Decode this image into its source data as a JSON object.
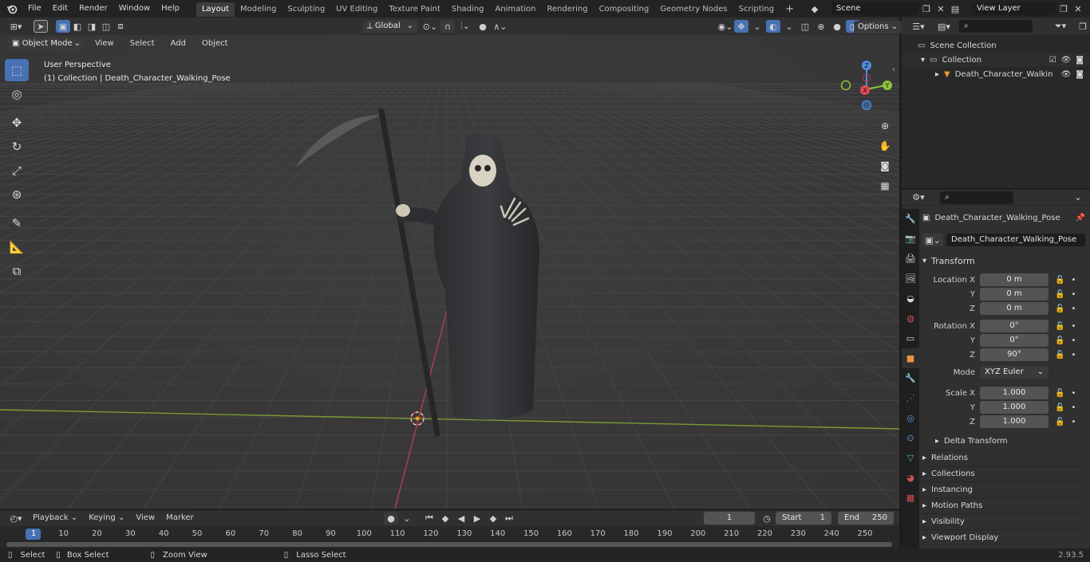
{
  "topbar": {
    "menus": [
      "File",
      "Edit",
      "Render",
      "Window",
      "Help"
    ],
    "workspaces": [
      "Layout",
      "Modeling",
      "Sculpting",
      "UV Editing",
      "Texture Paint",
      "Shading",
      "Animation",
      "Rendering",
      "Compositing",
      "Geometry Nodes",
      "Scripting"
    ],
    "active_workspace": "Layout",
    "add_tab": "+",
    "scene": "Scene",
    "view_layer": "View Layer"
  },
  "viewport_header": {
    "mode": "Object Mode",
    "menus": [
      "View",
      "Select",
      "Add",
      "Object"
    ],
    "orientation": "Global",
    "options": "Options"
  },
  "viewport": {
    "perspective": "User Perspective",
    "collection_info": "(1) Collection | Death_Character_Walking_Pose",
    "gizmo": {
      "x": "X",
      "y": "Y",
      "z": "Z"
    }
  },
  "outliner": {
    "scene_collection": "Scene Collection",
    "collection": "Collection",
    "object": "Death_Character_Walkin"
  },
  "properties": {
    "object_name": "Death_Character_Walking_Pose",
    "object_field": "Death_Character_Walking_Pose",
    "transform_title": "Transform",
    "location_label": "Location X",
    "rotation_label": "Rotation X",
    "scale_label": "Scale X",
    "y_label": "Y",
    "z_label": "Z",
    "location": [
      "0 m",
      "0 m",
      "0 m"
    ],
    "rotation": [
      "0°",
      "0°",
      "90°"
    ],
    "mode_label": "Mode",
    "mode_value": "XYZ Euler",
    "scale": [
      "1.000",
      "1.000",
      "1.000"
    ],
    "delta": "Delta Transform",
    "sections": [
      "Relations",
      "Collections",
      "Instancing",
      "Motion Paths",
      "Visibility",
      "Viewport Display"
    ]
  },
  "timeline": {
    "menus": [
      "Playback",
      "Keying",
      "View",
      "Marker"
    ],
    "current_frame": "1",
    "start_label": "Start",
    "start": "1",
    "end_label": "End",
    "end": "250",
    "ticks": [
      "1",
      "10",
      "20",
      "30",
      "40",
      "50",
      "60",
      "70",
      "80",
      "90",
      "100",
      "110",
      "120",
      "130",
      "140",
      "150",
      "160",
      "170",
      "180",
      "190",
      "200",
      "210",
      "220",
      "230",
      "240",
      "250"
    ]
  },
  "statusbar": {
    "select": "Select",
    "box_select": "Box Select",
    "zoom_view": "Zoom View",
    "lasso_select": "Lasso Select",
    "version": "2.93.5"
  },
  "colors": {
    "accent": "#4772b3",
    "x_axis": "#e24a5a",
    "y_axis": "#8cc63f",
    "z_axis": "#4f8fe0"
  }
}
